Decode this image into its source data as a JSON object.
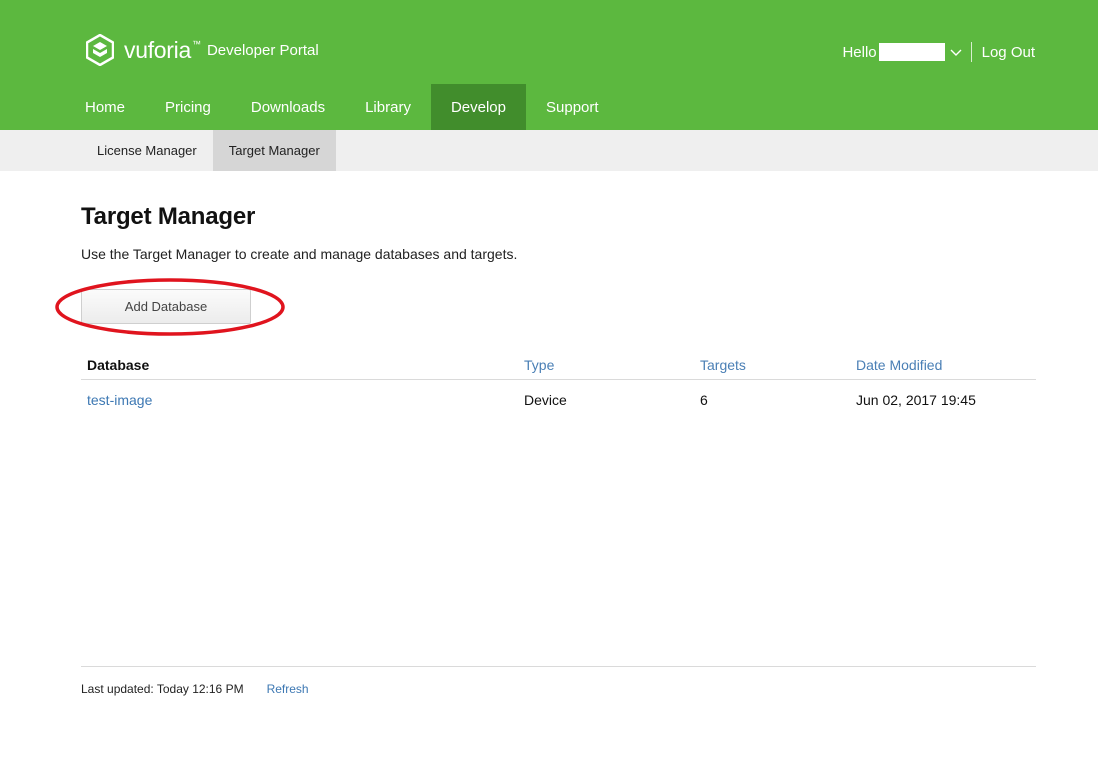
{
  "header": {
    "brand": "vuforia",
    "trademark": "™",
    "portal": "Developer Portal",
    "hello": "Hello",
    "logout": "Log Out",
    "bg_color": "#5cb83f",
    "active_color": "#418d2c"
  },
  "nav": {
    "items": [
      "Home",
      "Pricing",
      "Downloads",
      "Library",
      "Develop",
      "Support"
    ],
    "active": "Develop"
  },
  "subnav": {
    "items": [
      "License Manager",
      "Target Manager"
    ],
    "active": "Target Manager"
  },
  "main": {
    "title": "Target Manager",
    "description": "Use the Target Manager to create and manage databases and targets.",
    "add_button": "Add Database"
  },
  "table": {
    "columns": [
      "Database",
      "Type",
      "Targets",
      "Date Modified"
    ],
    "rows": [
      {
        "database": "test-image",
        "type": "Device",
        "targets": "6",
        "date_modified": "Jun 02, 2017 19:45"
      }
    ]
  },
  "footer": {
    "last_updated": "Last updated: Today 12:16 PM",
    "refresh": "Refresh"
  },
  "icons": {
    "logo": "vuforia-logo-icon",
    "user_menu": "chevron-down-icon"
  },
  "annotation_color": "#e0141e"
}
